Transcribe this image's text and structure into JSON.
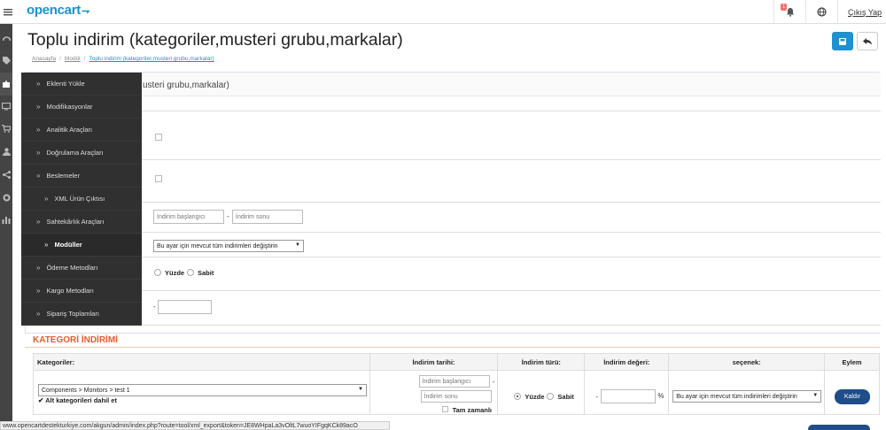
{
  "header": {
    "logo": "opencart",
    "logout": "Çıkış Yap",
    "notification_count": "1"
  },
  "page": {
    "title": "Toplu indirim (kategoriler,musteri grubu,markalar)",
    "breadcrumb": [
      "Anasayfa",
      "Modül",
      "Toplu indirim (kategoriler,musteri grubu,markalar)"
    ]
  },
  "panel": {
    "heading": "usteri grubu,markalar)",
    "date_start_placeholder": "İndirim başlangıcı",
    "date_end_placeholder": "İndirim sonu",
    "replace_select": "Bu ayar için mevcut tüm indirimleri değiştirin",
    "radio_percent": "Yüzde",
    "radio_fixed": "Sabit",
    "dash": "-"
  },
  "flyout": {
    "items": [
      {
        "label": "Eklenti Yükle"
      },
      {
        "label": "Modifikasyonlar"
      },
      {
        "label": "Analitik Araçları"
      },
      {
        "label": "Doğrulama Araçları"
      },
      {
        "label": "Beslemeler"
      },
      {
        "label": "XML Ürün Çıktısı"
      },
      {
        "label": "Sahtekârlık Araçları"
      },
      {
        "label": "Modüller"
      },
      {
        "label": "Ödeme Metodları"
      },
      {
        "label": "Kargo Metodları"
      },
      {
        "label": "Sipariş Toplamları"
      }
    ]
  },
  "category_section": {
    "title": "KATEGORİ İNDİRİMİ",
    "headers": [
      "Kategoriler:",
      "İndirim tarihi:",
      "İndirim türü:",
      "İndirim değeri:",
      "seçenek:",
      "Eylem"
    ],
    "row": {
      "category": "Components  >  Monitors  >  test 1",
      "include_sub": "Alt kategorileri dahil et",
      "date_start_placeholder": "İndirim başlangıcı",
      "date_end_placeholder": "İndirim sonu",
      "dash": "-",
      "full_time": "Tam zamanlı",
      "type_percent": "Yüzde",
      "type_fixed": "Sabit",
      "value_prefix": "-",
      "value_suffix": "%",
      "option": "Bu ayar için mevcut tüm indirimleri değiştirin",
      "action": "Kaldır"
    }
  },
  "statusbar": {
    "url": "www.opencartdestekturkiye.com/akgun/admin/index.php?route=tool/xml_export&token=JE8WHpaLa3vOltL7wuoYIFgqKCk89acO"
  }
}
